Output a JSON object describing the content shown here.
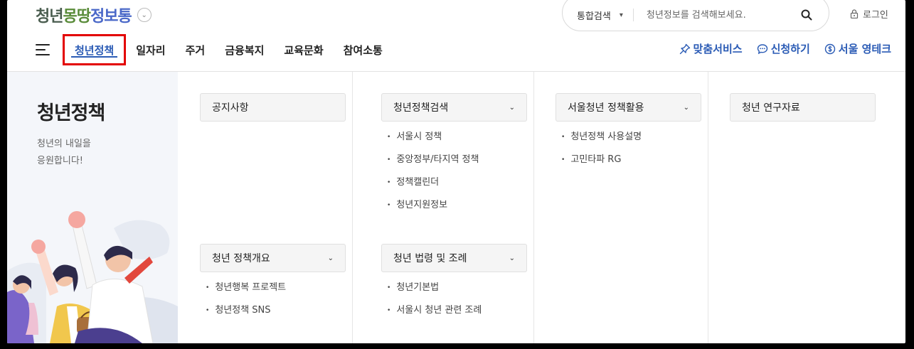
{
  "header": {
    "logo": {
      "part1": "청년",
      "part2": "몽땅",
      "part3": "정보통"
    },
    "search": {
      "category": "통합검색",
      "placeholder": "청년정보를 검색해보세요."
    },
    "login_label": "로그인"
  },
  "gnb": {
    "items": [
      {
        "label": "청년정책",
        "active": true
      },
      {
        "label": "일자리"
      },
      {
        "label": "주거"
      },
      {
        "label": "금융복지"
      },
      {
        "label": "교육문화"
      },
      {
        "label": "참여소통"
      }
    ]
  },
  "quick_links": [
    {
      "label": "맞춤서비스",
      "icon": "pin-icon"
    },
    {
      "label": "신청하기",
      "icon": "chat-icon"
    },
    {
      "label": "서울 영테크",
      "icon": "coin-icon"
    }
  ],
  "mega": {
    "title": "청년정책",
    "desc_line1": "청년의 내일을",
    "desc_line2": "응원합니다!",
    "columns": [
      {
        "groups": [
          {
            "title": "공지사항",
            "items": []
          },
          {
            "title": "청년 정책개요",
            "items": [
              "청년행복 프로젝트",
              "청년정책 SNS"
            ]
          }
        ]
      },
      {
        "groups": [
          {
            "title": "청년정책검색",
            "items": [
              "서울시 정책",
              "중앙정부/타지역 정책",
              "정책캘린더",
              "청년지원정보"
            ]
          },
          {
            "title": "청년 법령 및 조례",
            "items": [
              "청년기본법",
              "서울시 청년 관련 조례"
            ]
          }
        ]
      },
      {
        "groups": [
          {
            "title": "서울청년 정책활용",
            "items": [
              "청년정책 사용설명",
              "고민타파 RG"
            ]
          }
        ]
      },
      {
        "groups": [
          {
            "title": "청년 연구자료",
            "items": []
          }
        ]
      }
    ]
  },
  "colors": {
    "accent": "#2a5bb5",
    "highlight": "#e30000"
  }
}
